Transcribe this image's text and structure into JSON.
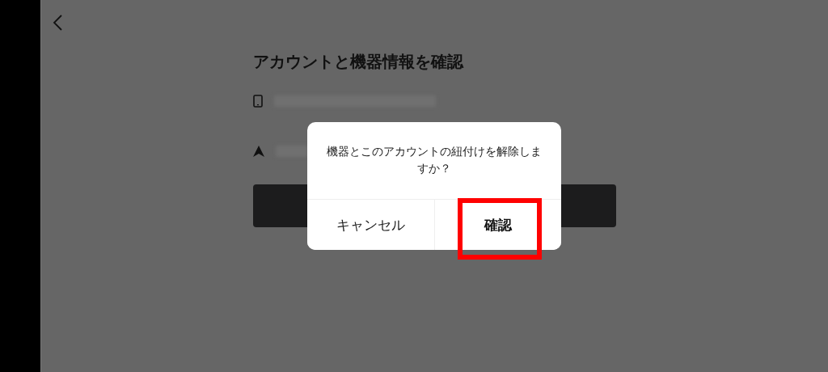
{
  "page": {
    "title": "アカウントと機器情報を確認"
  },
  "info_rows": [
    {
      "kind": "device"
    },
    {
      "kind": "location"
    }
  ],
  "dialog": {
    "message": "機器とこのアカウントの紐付けを解除しますか？",
    "buttons": [
      {
        "label": "キャンセル",
        "primary": false,
        "highlighted": false
      },
      {
        "label": "確認",
        "primary": true,
        "highlighted": true
      }
    ]
  }
}
